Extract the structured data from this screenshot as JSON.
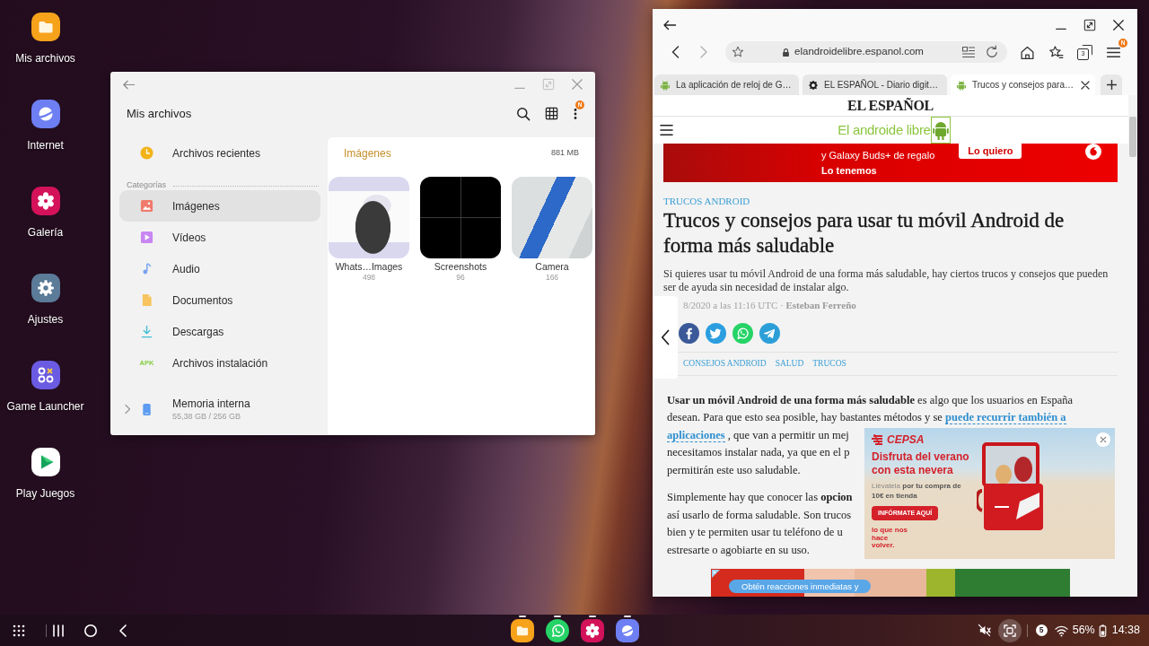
{
  "desktop": {
    "shortcuts": [
      {
        "label": "Mis archivos",
        "kind": "files"
      },
      {
        "label": "Internet",
        "kind": "internet"
      },
      {
        "label": "Galería",
        "kind": "gallery"
      },
      {
        "label": "Ajustes",
        "kind": "settings"
      },
      {
        "label": "Game Launcher",
        "kind": "games"
      },
      {
        "label": "Play Juegos",
        "kind": "play"
      }
    ]
  },
  "file_manager": {
    "title": "Mis archivos",
    "menu_badge": "N",
    "recent": {
      "label": "Archivos recientes",
      "selected": false
    },
    "section_label": "Categorías",
    "categories": [
      {
        "label": "Imágenes",
        "kind": "images",
        "selected": true
      },
      {
        "label": "Vídeos",
        "kind": "videos",
        "selected": false
      },
      {
        "label": "Audio",
        "kind": "audio",
        "selected": false
      },
      {
        "label": "Documentos",
        "kind": "documents",
        "selected": false
      },
      {
        "label": "Descargas",
        "kind": "downloads",
        "selected": false
      },
      {
        "label": "Archivos instalación",
        "kind": "apk",
        "icon_text": "APK",
        "selected": false
      }
    ],
    "storage": {
      "label": "Memoria interna",
      "detail": "55,38 GB / 256 GB",
      "expanded": false
    },
    "content": {
      "title": "Imágenes",
      "size": "881 MB",
      "folders": [
        {
          "name": "Whats…Images",
          "count": "498",
          "kind": "illustration"
        },
        {
          "name": "Screenshots",
          "count": "96",
          "kind": "dark"
        },
        {
          "name": "Camera",
          "count": "166",
          "kind": "photo"
        }
      ]
    }
  },
  "browser": {
    "nav": [
      {
        "kind": "back",
        "disabled": false
      },
      {
        "kind": "forward",
        "disabled": true
      }
    ],
    "address": "elandroidelibre.espanol.com",
    "tab_count": "3",
    "menu_badge": "N",
    "tabs": [
      {
        "title": "La aplicación de reloj de G…",
        "kind": "tech_site",
        "selected": false
      },
      {
        "title": "EL ESPAÑOL - Diario digit…",
        "kind": "newspaper",
        "selected": false
      },
      {
        "title": "Trucos y consejos para…",
        "kind": "tech_site",
        "selected": true
      }
    ],
    "page": {
      "masthead": "EL ESPAÑOL",
      "logo": "El androide libre",
      "top_ad": {
        "lines": [
          "y Galaxy Buds+ de regalo",
          "Lo tenemos"
        ],
        "button": "Lo quiero"
      },
      "article": {
        "category": "TRUCOS ANDROID",
        "title": "Trucos y consejos para usar tu móvil Android de forma más saludable",
        "summary": "Si quieres usar tu móvil Android de una forma más saludable, hay ciertos trucos y consejos que pueden ser de ayuda sin necesidad de instalar algo.",
        "byline": "8/2020 a las 11:16 UTC · **Esteban Ferreño**",
        "share": [
          {
            "kind": "facebook",
            "color": "#3b5998"
          },
          {
            "kind": "twitter",
            "color": "#2b9ee0"
          },
          {
            "kind": "whatsapp",
            "color": "#25d366"
          },
          {
            "kind": "telegram",
            "color": "#2c9fd8"
          }
        ],
        "tags": [
          "CONSEJOS ANDROID",
          "SALUD",
          "TRUCOS"
        ],
        "paragraphs": [
          [
            [
              {
                "kind": "text",
                "text": "**Usar un móvil Android de una forma más saludable** es algo que los usuarios en España"
              }
            ],
            [
              {
                "kind": "text",
                "text": "desean. Para que esto sea posible, hay bastantes métodos y se "
              },
              {
                "kind": "link",
                "text": "puede recurrir también a"
              }
            ],
            [
              {
                "kind": "link",
                "text": "aplicaciones"
              },
              {
                "kind": "text",
                "text": " , que van a permitir un mej"
              }
            ],
            [
              {
                "kind": "text",
                "text": "necesitamos instalar nada, ya que en el p"
              }
            ],
            [
              {
                "kind": "text",
                "text": "permitirán este uso saludable."
              }
            ]
          ],
          [
            [
              {
                "kind": "text",
                "text": "Simplemente hay que conocer las **opcion**"
              }
            ],
            [
              {
                "kind": "text",
                "text": "así usarlo de forma saludable. Son trucos"
              }
            ],
            [
              {
                "kind": "text",
                "text": "bien y te permiten usar tu teléfono de u"
              }
            ],
            [
              {
                "kind": "text",
                "text": "estresarte o agobiarte en su uso."
              }
            ]
          ]
        ]
      },
      "popup_ad": {
        "brand": "CEPSA",
        "headline": "Disfruta del verano con esta nevera",
        "offer": "Llévatela **por tu compra de 10€ en tienda**",
        "button": "INFÓRMATE AQUÍ",
        "slogan": "lo que nos hace volver."
      },
      "bottom_ad": {
        "text": "Obtén reacciones inmediatas y"
      }
    }
  },
  "taskbar": {
    "apps": [
      {
        "kind": "files",
        "running": true
      },
      {
        "kind": "whatsapp",
        "running": true
      },
      {
        "kind": "gallery",
        "running": true
      },
      {
        "kind": "internet",
        "running": true
      }
    ],
    "notifications": "5",
    "battery": "56%",
    "time": "14:38"
  }
}
